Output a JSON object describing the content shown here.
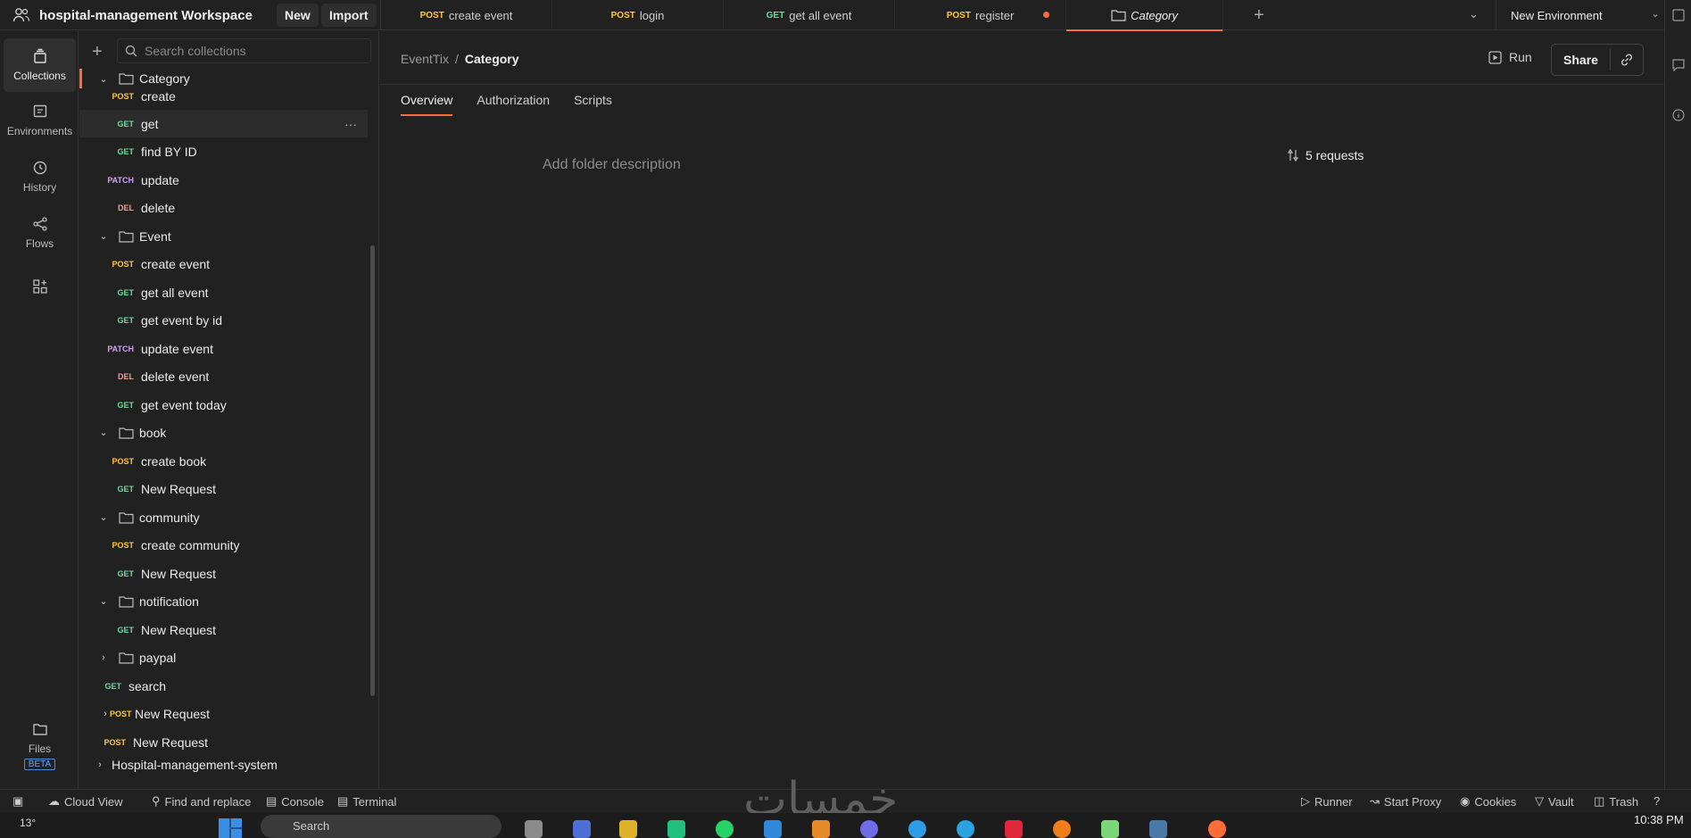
{
  "topbar": {
    "workspace_name": "hospital-management Workspace",
    "new_label": "New",
    "import_label": "Import",
    "tabs": [
      {
        "method": "POST",
        "label": "create event"
      },
      {
        "method": "POST",
        "label": "login"
      },
      {
        "method": "GET",
        "label": "get all event"
      },
      {
        "method": "POST",
        "label": "register",
        "unsaved": true
      },
      {
        "method": "",
        "label": "Category",
        "active": true
      }
    ],
    "environment": "New Environment"
  },
  "rail": {
    "collections": "Collections",
    "environments": "Environments",
    "history": "History",
    "flows": "Flows",
    "files": "Files",
    "beta": "BETA"
  },
  "sidebar": {
    "search_placeholder": "Search collections",
    "tree": [
      {
        "type": "folder",
        "label": "Category",
        "expanded": true
      },
      {
        "method": "POST",
        "label": "create"
      },
      {
        "method": "GET",
        "label": "get",
        "highlighted": true
      },
      {
        "method": "GET",
        "label": "find BY ID"
      },
      {
        "method": "PATCH",
        "label": "update"
      },
      {
        "method": "DEL",
        "label": "delete"
      },
      {
        "type": "folder",
        "label": "Event",
        "expanded": true
      },
      {
        "method": "POST",
        "label": "create event"
      },
      {
        "method": "GET",
        "label": "get all event"
      },
      {
        "method": "GET",
        "label": "get event by id"
      },
      {
        "method": "PATCH",
        "label": "update event"
      },
      {
        "method": "DEL",
        "label": "delete event"
      },
      {
        "method": "GET",
        "label": "get event today"
      },
      {
        "type": "folder",
        "label": "book",
        "expanded": true
      },
      {
        "method": "POST",
        "label": "create book"
      },
      {
        "method": "GET",
        "label": "New Request"
      },
      {
        "type": "folder",
        "label": "community",
        "expanded": true
      },
      {
        "method": "POST",
        "label": "create community"
      },
      {
        "method": "GET",
        "label": "New Request"
      },
      {
        "type": "folder",
        "label": "notification",
        "expanded": true
      },
      {
        "method": "GET",
        "label": "New Request"
      },
      {
        "type": "folder",
        "label": "paypal",
        "expanded": false
      },
      {
        "method": "GET",
        "label": "search",
        "level": 1
      },
      {
        "method": "POST",
        "label": "New Request",
        "level": 1,
        "expandable": true
      },
      {
        "method": "POST",
        "label": "New Request",
        "level": 1
      },
      {
        "type": "collection",
        "label": "Hospital-management-system"
      }
    ]
  },
  "main": {
    "breadcrumb_parent": "EventTix",
    "breadcrumb_separator": "/",
    "breadcrumb_current": "Category",
    "run_label": "Run",
    "share_label": "Share",
    "subtabs": [
      "Overview",
      "Authorization",
      "Scripts"
    ],
    "active_subtab": "Overview",
    "folder_description_placeholder": "Add folder description",
    "requests_count": "5 requests"
  },
  "statusbar": {
    "cloud_view": "Cloud View",
    "find_replace": "Find and replace",
    "console": "Console",
    "terminal": "Terminal",
    "runner": "Runner",
    "start_proxy": "Start Proxy",
    "cookies": "Cookies",
    "vault": "Vault",
    "trash": "Trash",
    "watermark": "خمسات"
  },
  "taskbar": {
    "temperature": "13°",
    "search_placeholder": "Search",
    "time": "10:38 PM"
  },
  "colors": {
    "accent": "#ff6c37",
    "GET": "#6bdd9a",
    "POST": "#ffc93d",
    "PATCH": "#c9a4f1",
    "DEL": "#f79a8e"
  }
}
